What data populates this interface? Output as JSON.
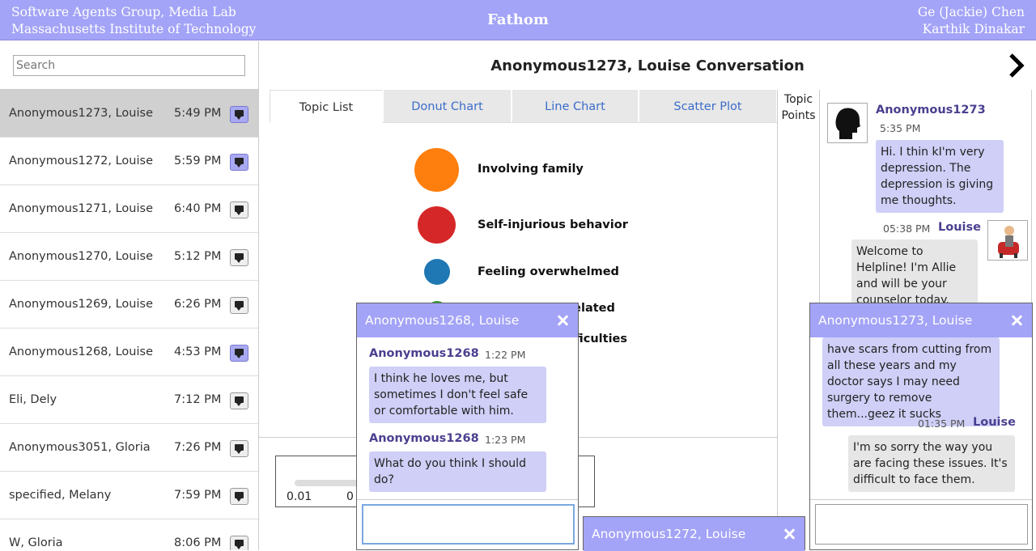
{
  "header": {
    "lab_line1": "Software Agents Group, Media Lab",
    "lab_line2": "Massachusetts Institute of Technology",
    "app_title": "Fathom",
    "author1": "Ge (Jackie) Chen",
    "author2": "Karthik Dinakar"
  },
  "search": {
    "placeholder": "Search"
  },
  "conversations": [
    {
      "name": "Anonymous1273, Louise",
      "time": "5:49 PM",
      "unread": true
    },
    {
      "name": "Anonymous1272, Louise",
      "time": "5:59 PM",
      "unread": true
    },
    {
      "name": "Anonymous1271, Louise",
      "time": "6:40 PM",
      "unread": false
    },
    {
      "name": "Anonymous1270, Louise",
      "time": "5:12 PM",
      "unread": false
    },
    {
      "name": "Anonymous1269, Louise",
      "time": "6:26 PM",
      "unread": false
    },
    {
      "name": "Anonymous1268, Louise",
      "time": "4:53 PM",
      "unread": true
    },
    {
      "name": "Eli, Dely",
      "time": "7:12 PM",
      "unread": false
    },
    {
      "name": "Anonymous3051, Gloria",
      "time": "7:26 PM",
      "unread": false
    },
    {
      "name": "specified, Melany",
      "time": "7:59 PM",
      "unread": false
    },
    {
      "name": "W, Gloria",
      "time": "8:06 PM",
      "unread": false
    }
  ],
  "main": {
    "conversation_title": "Anonymous1273, Louise Conversation",
    "tabs": [
      {
        "label": "Topic List"
      },
      {
        "label": "Donut Chart"
      },
      {
        "label": "Line Chart"
      },
      {
        "label": "Scatter Plot"
      }
    ],
    "topics": [
      {
        "label": "Involving family",
        "color": "#ff7f0e"
      },
      {
        "label": "Self-injurious behavior",
        "color": "#d62728"
      },
      {
        "label": "Feeling overwhelmed",
        "color": "#1f77b4"
      },
      {
        "label": "related",
        "color": "#2ca02c"
      },
      {
        "label": "ficulties",
        "color": "#9467bd"
      }
    ],
    "slider": {
      "min_label": "0.01",
      "max_label_partial": "0"
    }
  },
  "right_pane": {
    "topic_points_label": "Topic Points",
    "messages": [
      {
        "sender": "Anonymous1273",
        "time": "5:35 PM",
        "text": "Hi. I thin kI'm very depression. The depression is giving me thoughts."
      },
      {
        "sender": "Louise",
        "time": "05:38 PM",
        "text": "Welcome to Helpline! I'm Allie and will be your counselor today. Can"
      }
    ]
  },
  "popup_1268": {
    "title": "Anonymous1268, Louise",
    "messages": [
      {
        "sender": "Anonymous1268",
        "time": "1:22 PM",
        "text": "I think he loves me, but sometimes I don't feel safe or comfortable with him."
      },
      {
        "sender": "Anonymous1268",
        "time": "1:23 PM",
        "text": "What do you think I should do?"
      }
    ]
  },
  "popup_1272": {
    "title": "Anonymous1272, Louise"
  },
  "popup_1273": {
    "title": "Anonymous1273, Louise",
    "messages": [
      {
        "text": "have scars from cutting from all these years and my doctor says I may need surgery to remove them...geez it sucks"
      },
      {
        "sender": "Louise",
        "time": "01:35 PM",
        "text": "I'm so sorry the way you are facing these issues. It's difficult to face them."
      }
    ]
  }
}
